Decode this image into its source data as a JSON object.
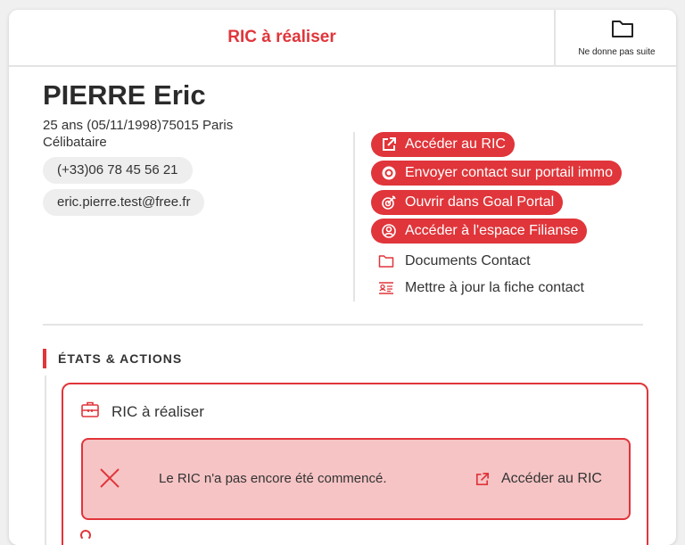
{
  "header": {
    "title": "RIC à réaliser",
    "action_label": "Ne donne pas suite",
    "action_icon": "folder-icon"
  },
  "contact": {
    "name": "PIERRE Eric",
    "age_birth_location": "25 ans (05/11/1998)75015 Paris",
    "marital_status": "Célibataire",
    "phone": "(+33)06 78 45 56 21",
    "email": "eric.pierre.test@free.fr"
  },
  "actions": {
    "primary": [
      {
        "label": "Accéder au RIC",
        "icon": "external-link-icon"
      },
      {
        "label": "Envoyer contact sur portail immo",
        "icon": "radio-dot-icon"
      },
      {
        "label": "Ouvrir dans Goal Portal",
        "icon": "target-icon"
      },
      {
        "label": "Accéder à l'espace Filianse",
        "icon": "user-circle-icon"
      }
    ],
    "secondary": [
      {
        "label": "Documents Contact",
        "icon": "folder-icon"
      },
      {
        "label": "Mettre à jour la fiche contact",
        "icon": "id-card-icon"
      }
    ]
  },
  "section": {
    "title": "ÉTATS & ACTIONS"
  },
  "state": {
    "title": "RIC à réaliser",
    "icon": "briefcase-icon",
    "alert_message": "Le RIC n'a pas encore été commencé.",
    "alert_link": "Accéder au RIC"
  },
  "colors": {
    "accent": "#e0353a",
    "alert_bg": "#f6c4c5",
    "pill_bg": "#eeeeee"
  }
}
